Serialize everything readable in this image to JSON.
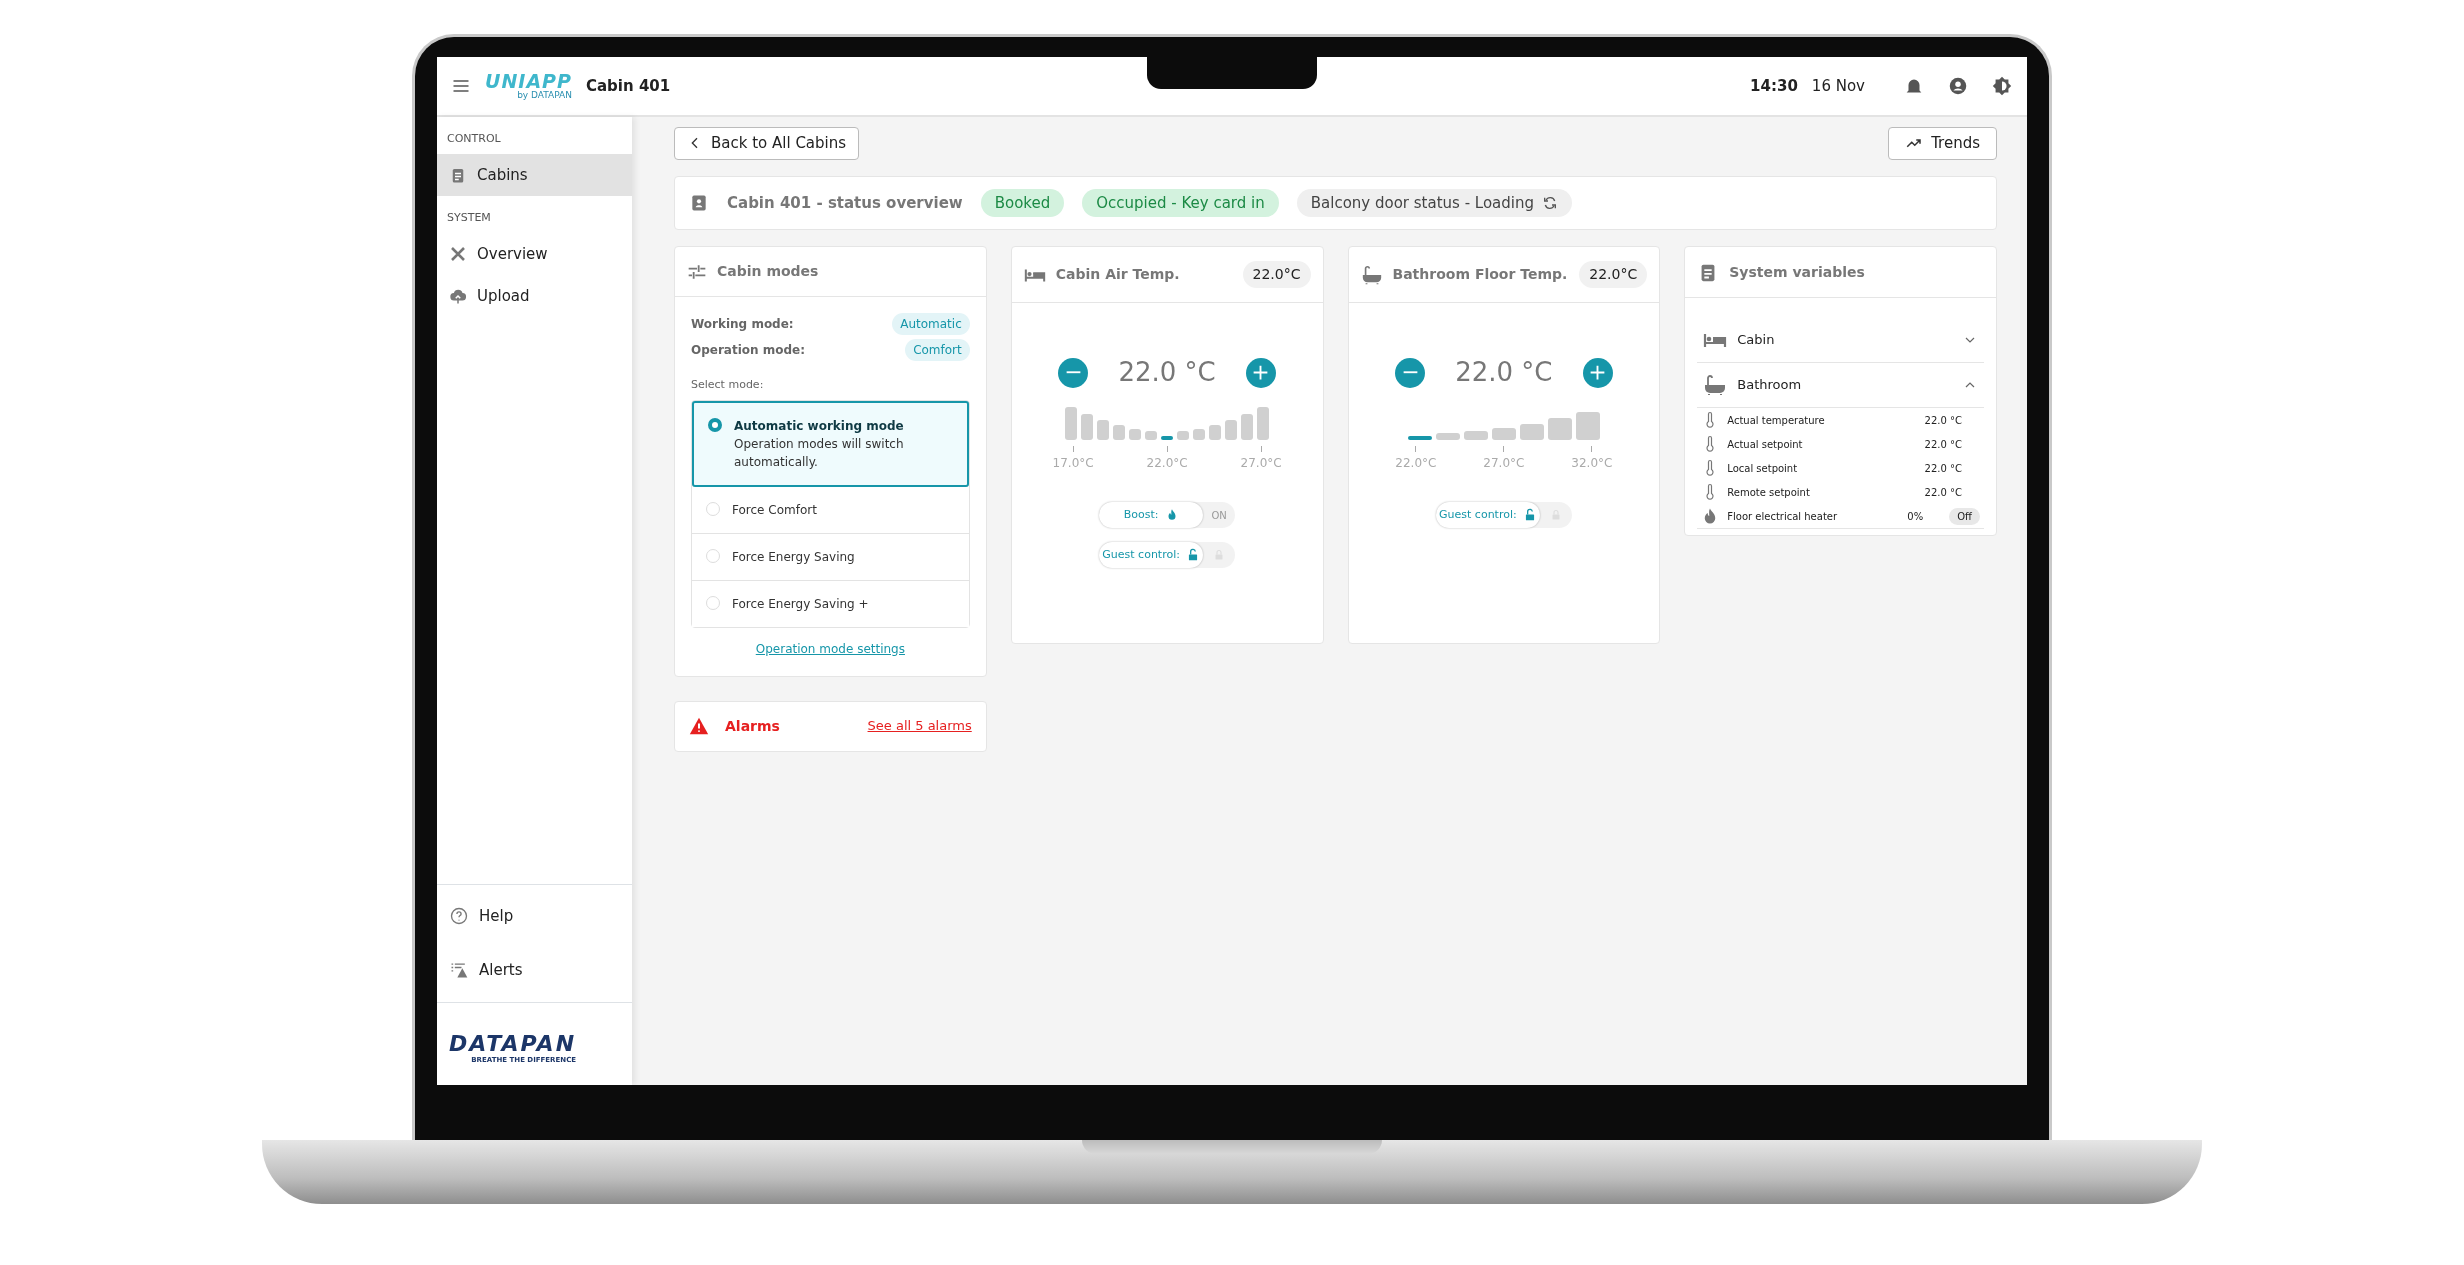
{
  "topbar": {
    "logo": "UNIAPP",
    "logo_sub": "by DATAPAN",
    "title": "Cabin 401",
    "time": "14:30",
    "date": "16 Nov"
  },
  "sidebar": {
    "sections": [
      {
        "heading": "CONTROL",
        "items": [
          {
            "label": "Cabins",
            "selected": true
          }
        ]
      },
      {
        "heading": "SYSTEM",
        "items": [
          {
            "label": "Overview",
            "selected": false
          },
          {
            "label": "Upload",
            "selected": false
          }
        ]
      }
    ],
    "bottom_items": [
      {
        "label": "Help"
      },
      {
        "label": "Alerts"
      }
    ],
    "brand": {
      "name": "DATAPAN",
      "tagline": "BREATHE THE DIFFERENCE"
    }
  },
  "back_button": "Back to All Cabins",
  "trends_button": "Trends",
  "status": {
    "title": "Cabin 401 - status overview",
    "badges": [
      {
        "text": "Booked",
        "kind": "success"
      },
      {
        "text": "Occupied - Key card in",
        "kind": "success"
      },
      {
        "text": "Balcony door status - Loading",
        "kind": "loading"
      }
    ]
  },
  "cabin_modes": {
    "title": "Cabin modes",
    "fields": [
      {
        "label": "Working mode:",
        "value": "Automatic"
      },
      {
        "label": "Operation mode:",
        "value": "Comfort"
      }
    ],
    "select_label": "Select mode:",
    "options": [
      {
        "label": "Automatic working mode",
        "description": "Operation modes will switch automatically.",
        "selected": true
      },
      {
        "label": "Force Comfort",
        "selected": false
      },
      {
        "label": "Force Energy Saving",
        "selected": false
      },
      {
        "label": "Force Energy Saving +",
        "selected": false
      }
    ],
    "link": "Operation mode settings"
  },
  "temperature_cards": [
    {
      "title": "Cabin Air Temp.",
      "reading": "22.0°C",
      "value": "22.0",
      "unit": "°C",
      "kind": "v-shape",
      "steps": [
        {
          "selected": false
        },
        {
          "selected": false
        },
        {
          "selected": false
        },
        {
          "selected": false
        },
        {
          "selected": false
        },
        {
          "selected": false
        },
        {
          "selected": true
        },
        {
          "selected": false
        },
        {
          "selected": false
        },
        {
          "selected": false
        },
        {
          "selected": false
        },
        {
          "selected": false
        },
        {
          "selected": false
        }
      ],
      "ticks": [
        "17.0°C",
        "22.0°C",
        "27.0°C"
      ],
      "toggles": [
        {
          "label": "Boost:",
          "kind": "boost",
          "state_text": "ON",
          "on": false
        },
        {
          "label": "Guest control:",
          "kind": "lock",
          "on": false
        }
      ]
    },
    {
      "title": "Bathroom Floor Temp.",
      "reading": "22.0°C",
      "value": "22.0",
      "unit": "°C",
      "kind": "ramp",
      "steps": [
        {
          "selected": true
        },
        {
          "selected": false
        },
        {
          "selected": false
        },
        {
          "selected": false
        },
        {
          "selected": false
        },
        {
          "selected": false
        },
        {
          "selected": false
        }
      ],
      "ticks": [
        "22.0°C",
        "27.0°C",
        "32.0°C"
      ],
      "toggles": [
        {
          "label": "Guest control:",
          "kind": "lock",
          "on": false
        }
      ]
    }
  ],
  "system_variables": {
    "title": "System variables",
    "groups": [
      {
        "label": "Cabin",
        "expanded": false
      },
      {
        "label": "Bathroom",
        "expanded": true,
        "rows": [
          {
            "kind": "thermometer",
            "label": "Actual temperature",
            "value": "22.0 °C"
          },
          {
            "kind": "thermometer",
            "label": "Actual setpoint",
            "value": "22.0 °C"
          },
          {
            "kind": "thermometer",
            "label": "Local setpoint",
            "value": "22.0 °C"
          },
          {
            "kind": "thermometer",
            "label": "Remote setpoint",
            "value": "22.0 °C"
          },
          {
            "kind": "heater",
            "label": "Floor electrical heater",
            "value": "0%",
            "state": "Off"
          }
        ]
      }
    ]
  },
  "alarms": {
    "title": "Alarms",
    "link": "See all 5 alarms"
  }
}
